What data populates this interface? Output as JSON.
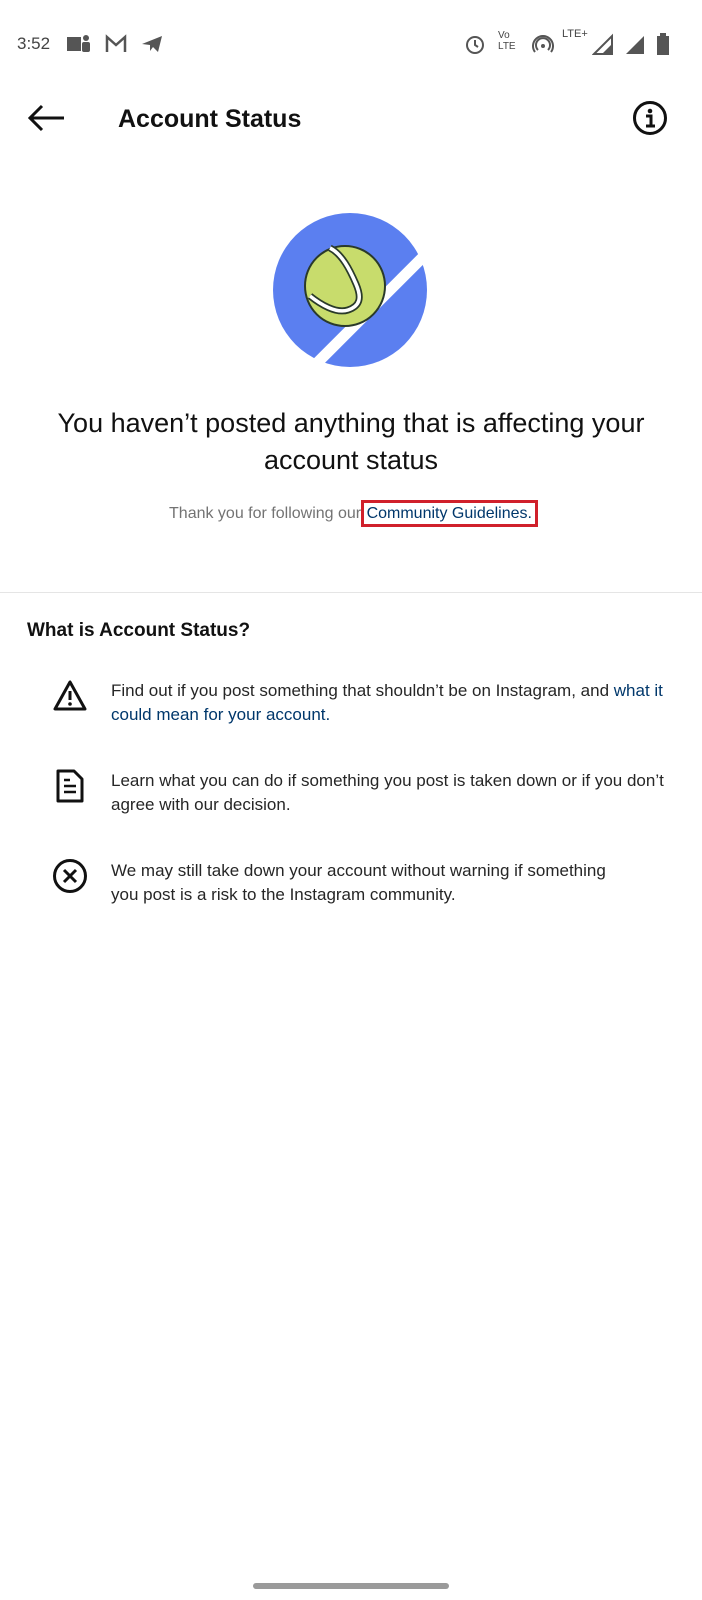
{
  "status_bar": {
    "time": "3:52",
    "left_icons": [
      "teams-icon",
      "gmail-icon",
      "telegram-icon"
    ],
    "right_icons": [
      "alarm-icon",
      "volte-icon",
      "hotspot-icon",
      "lte-plus-signal-icon",
      "signal-icon",
      "battery-icon"
    ],
    "volte_label": "Vo LTE",
    "lte_label": "LTE+"
  },
  "header": {
    "title": "Account Status",
    "back_icon": "arrow-left-icon",
    "info_icon": "info-icon"
  },
  "hero": {
    "headline": "You haven’t posted anything that is affecting your account status",
    "thanks_prefix": "Thank you for following our ",
    "guidelines_link": "Community Guidelines.",
    "colors": {
      "blue": "#5b7ff0",
      "ball": "#c8dc6c",
      "highlight": "#d0202b"
    }
  },
  "section": {
    "title": "What is Account Status?",
    "items": [
      {
        "icon": "warning-icon",
        "text": "Find out if you post something that shouldn’t be on Instagram, and ",
        "link": "what it could mean for your account."
      },
      {
        "icon": "document-icon",
        "text": "Learn what you can do if something you post is taken down or if you don’t agree with our decision."
      },
      {
        "icon": "circle-x-icon",
        "text": "We may still take down your account without warning if something you post is a risk to the Instagram community."
      }
    ]
  }
}
